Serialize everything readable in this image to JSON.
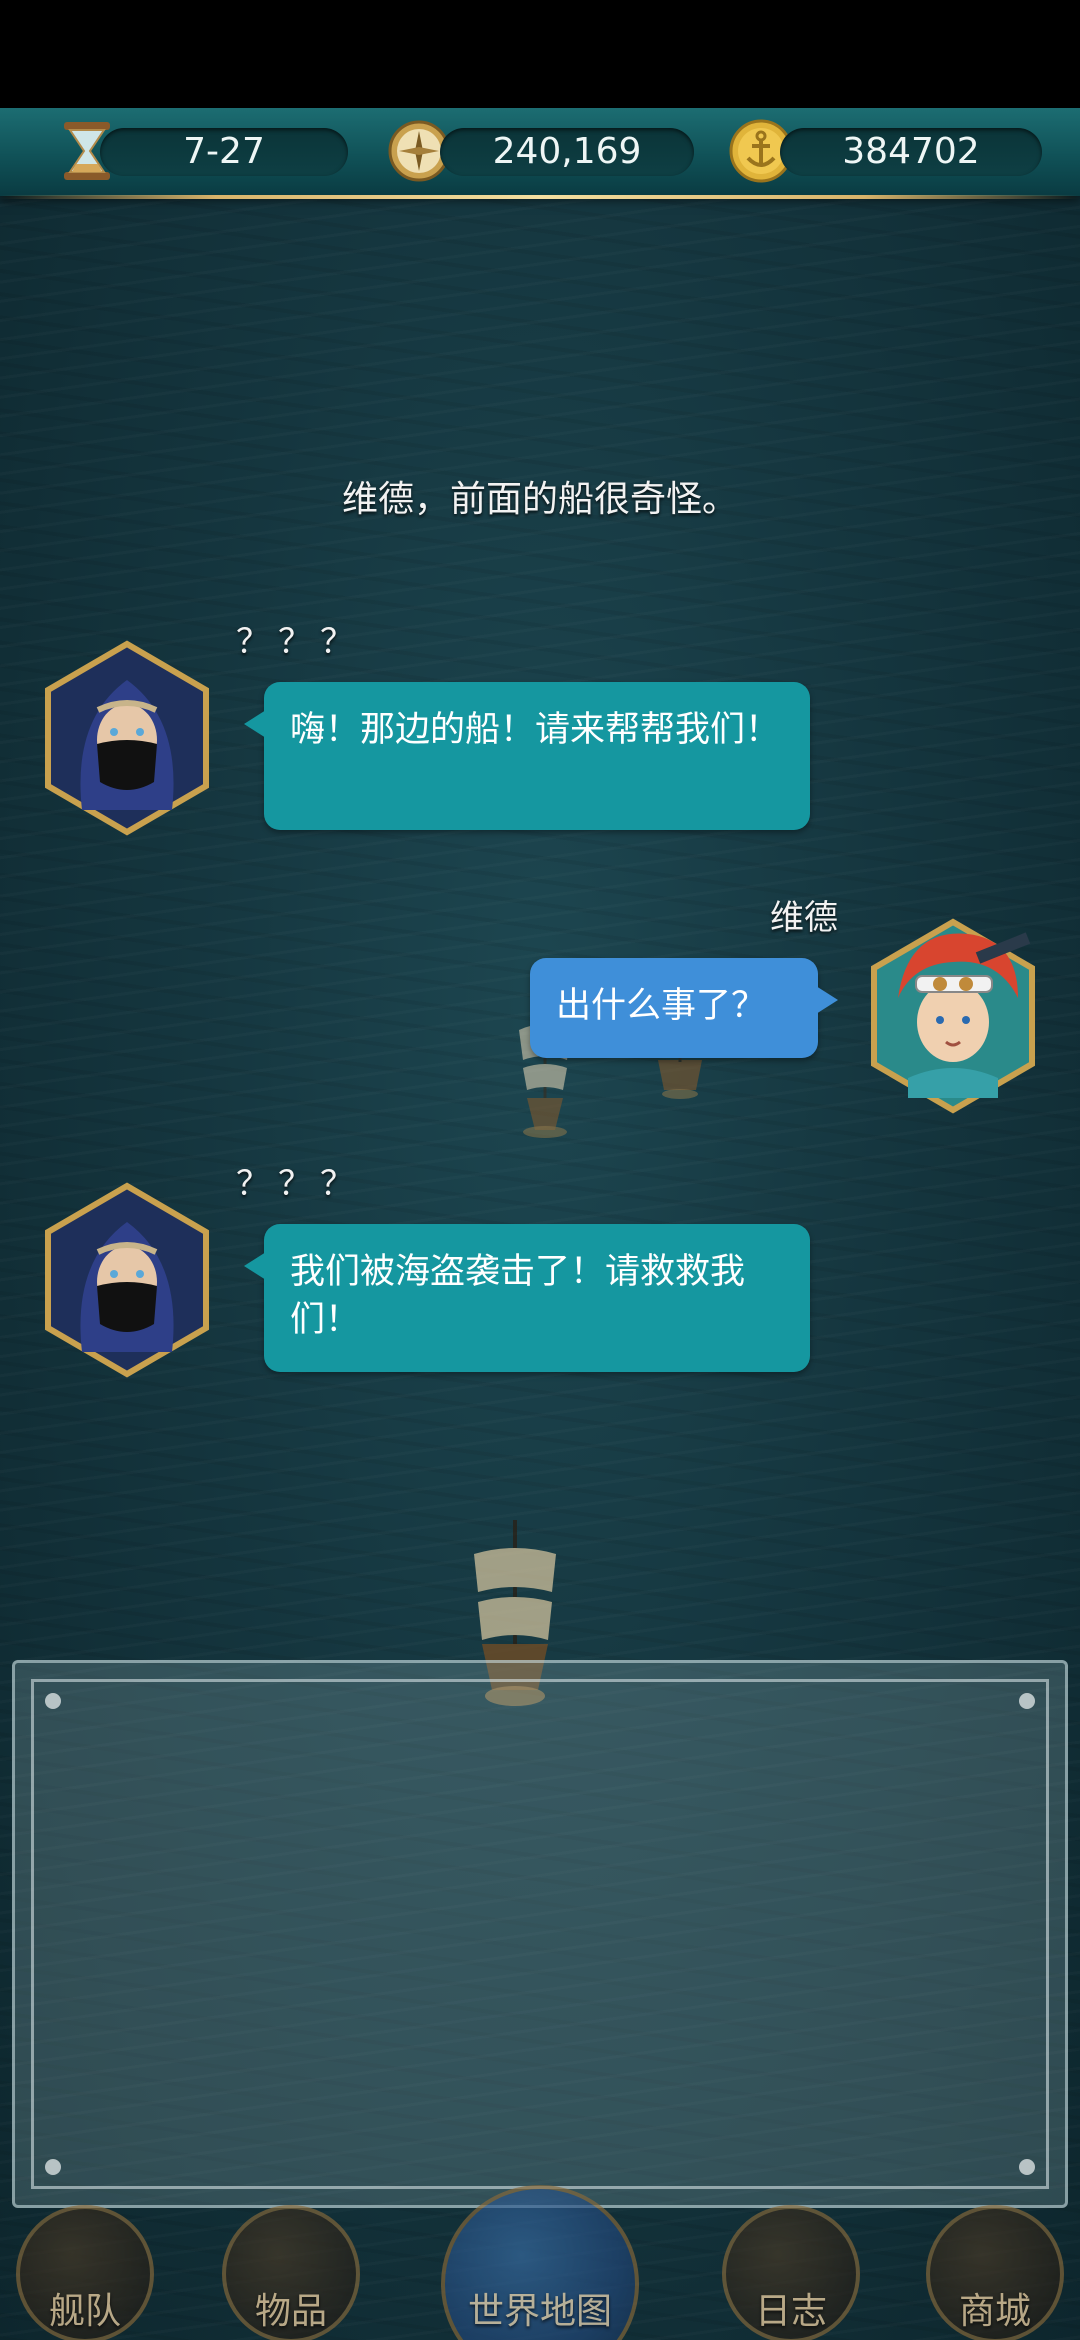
{
  "resources": {
    "date": "7-27",
    "compass_value": "240,169",
    "coins": "384702",
    "icons": [
      "hourglass-icon",
      "compass-icon",
      "anchor-coin-icon"
    ]
  },
  "narration": "维德，前面的船很奇怪。",
  "dialogue": [
    {
      "speaker": "？？？",
      "text": "嗨！那边的船！请来帮帮我们！",
      "side": "left",
      "bubble_color": "#1597a0"
    },
    {
      "speaker": "维德",
      "text": "出什么事了？",
      "side": "right",
      "bubble_color": "#3f8fd9"
    },
    {
      "speaker": "？？？",
      "text": "我们被海盗袭击了！请救救我们！",
      "side": "left",
      "bubble_color": "#1597a0"
    }
  ],
  "nav": {
    "fleet": "舰队",
    "items": "物品",
    "world_map": "世界地图",
    "log": "日志",
    "shop": "商城"
  },
  "colors": {
    "sea": "#15363f",
    "topbar": "#0f4f55",
    "gold_trim": "#d8b36a"
  }
}
